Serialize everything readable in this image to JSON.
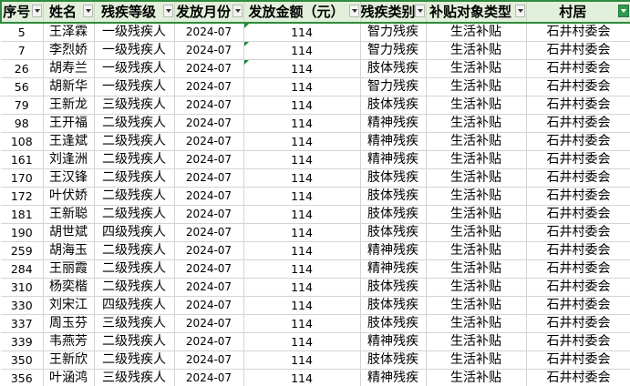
{
  "sheet": {
    "headers": [
      "序号",
      "姓名",
      "残疾等级",
      "发放月份",
      "发放金额（元）",
      "残疾类别",
      "补贴对象类型",
      "村居"
    ],
    "rows": [
      [
        "5",
        "王泽霖",
        "一级残疾人",
        "2024-07",
        "114",
        "智力残疾",
        "生活补贴",
        "石井村委会"
      ],
      [
        "7",
        "李烈娇",
        "一级残疾人",
        "2024-07",
        "114",
        "智力残疾",
        "生活补贴",
        "石井村委会"
      ],
      [
        "26",
        "胡寿兰",
        "一级残疾人",
        "2024-07",
        "114",
        "肢体残疾",
        "生活补贴",
        "石井村委会"
      ],
      [
        "56",
        "胡新华",
        "一级残疾人",
        "2024-07",
        "114",
        "智力残疾",
        "生活补贴",
        "石井村委会"
      ],
      [
        "79",
        "王新龙",
        "三级残疾人",
        "2024-07",
        "114",
        "肢体残疾",
        "生活补贴",
        "石井村委会"
      ],
      [
        "98",
        "王开福",
        "二级残疾人",
        "2024-07",
        "114",
        "精神残疾",
        "生活补贴",
        "石井村委会"
      ],
      [
        "108",
        "王逢斌",
        "二级残疾人",
        "2024-07",
        "114",
        "精神残疾",
        "生活补贴",
        "石井村委会"
      ],
      [
        "161",
        "刘逢洲",
        "二级残疾人",
        "2024-07",
        "114",
        "精神残疾",
        "生活补贴",
        "石井村委会"
      ],
      [
        "170",
        "王汉锋",
        "二级残疾人",
        "2024-07",
        "114",
        "肢体残疾",
        "生活补贴",
        "石井村委会"
      ],
      [
        "172",
        "叶伏娇",
        "二级残疾人",
        "2024-07",
        "114",
        "肢体残疾",
        "生活补贴",
        "石井村委会"
      ],
      [
        "181",
        "王新聪",
        "二级残疾人",
        "2024-07",
        "114",
        "肢体残疾",
        "生活补贴",
        "石井村委会"
      ],
      [
        "190",
        "胡世斌",
        "四级残疾人",
        "2024-07",
        "114",
        "肢体残疾",
        "生活补贴",
        "石井村委会"
      ],
      [
        "259",
        "胡海玉",
        "二级残疾人",
        "2024-07",
        "114",
        "精神残疾",
        "生活补贴",
        "石井村委会"
      ],
      [
        "284",
        "王丽霞",
        "二级残疾人",
        "2024-07",
        "114",
        "精神残疾",
        "生活补贴",
        "石井村委会"
      ],
      [
        "310",
        "杨奕楷",
        "二级残疾人",
        "2024-07",
        "114",
        "肢体残疾",
        "生活补贴",
        "石井村委会"
      ],
      [
        "330",
        "刘宋江",
        "四级残疾人",
        "2024-07",
        "114",
        "肢体残疾",
        "生活补贴",
        "石井村委会"
      ],
      [
        "337",
        "周玉芬",
        "三级残疾人",
        "2024-07",
        "114",
        "肢体残疾",
        "生活补贴",
        "石井村委会"
      ],
      [
        "339",
        "韦燕芳",
        "二级残疾人",
        "2024-07",
        "114",
        "精神残疾",
        "生活补贴",
        "石井村委会"
      ],
      [
        "350",
        "王新欣",
        "二级残疾人",
        "2024-07",
        "114",
        "肢体残疾",
        "生活补贴",
        "石井村委会"
      ],
      [
        "356",
        "叶涵鸿",
        "三级残疾人",
        "2024-07",
        "114",
        "精神残疾",
        "生活补贴",
        "石井村委会"
      ]
    ],
    "error_marker_rows": [
      0,
      1,
      2
    ],
    "colors": {
      "header_fill": "#e2efda",
      "header_border": "#2e8b3d",
      "active_filter": "#2e9a4a",
      "grid": "#d4d4d4"
    }
  }
}
